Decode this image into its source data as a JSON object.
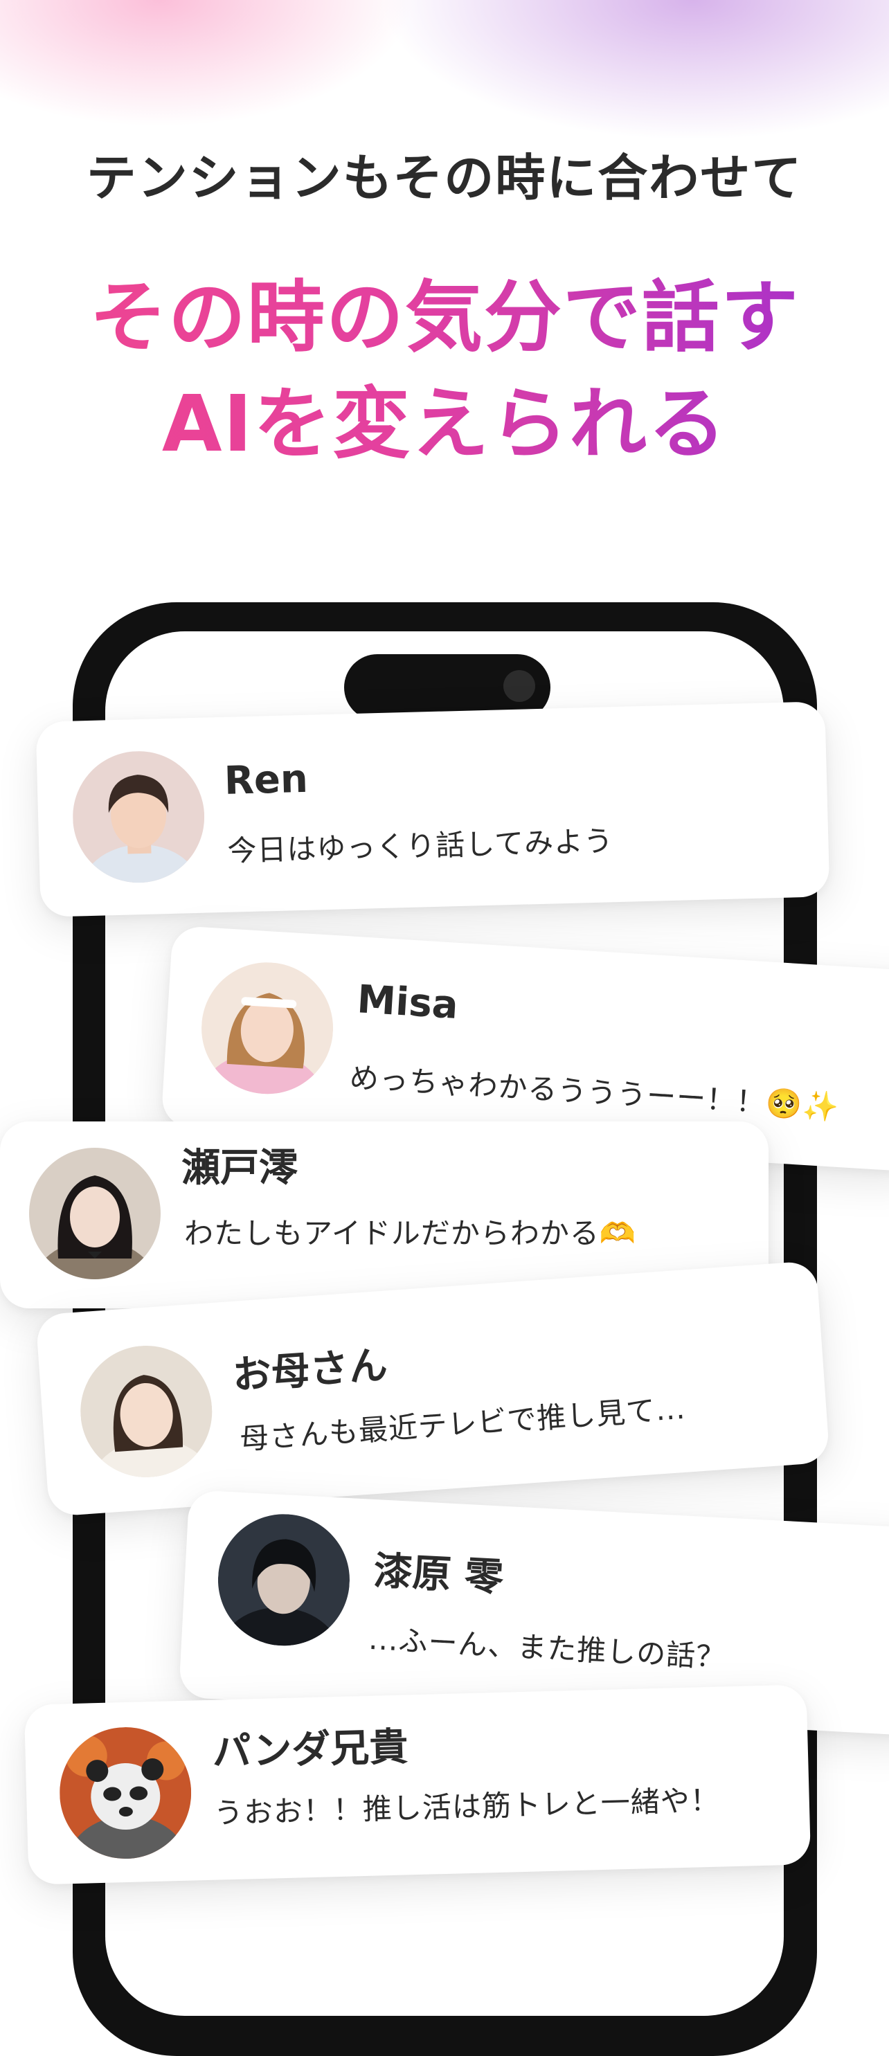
{
  "header": {
    "subtitle": "テンションもその時に合わせて",
    "headline_line1": "その時の気分で話す",
    "headline_line2": "AIを変えられる"
  },
  "chats": [
    {
      "name": "Ren",
      "message": "今日はゆっくり話してみよう",
      "avatar": "young-man-avatar"
    },
    {
      "name": "Misa",
      "message": "めっちゃわかるうううーー！！🥺✨",
      "avatar": "idol-girl-avatar"
    },
    {
      "name": "瀬戸澪",
      "message": "わたしもアイドルだからわかる🫶",
      "avatar": "schoolgirl-avatar"
    },
    {
      "name": "お母さん",
      "message": "母さんも最近テレビで推し見て...",
      "avatar": "mother-avatar"
    },
    {
      "name": "漆原 零",
      "message": "...ふーん、また推しの話？",
      "avatar": "dark-haired-man-avatar"
    },
    {
      "name": "パンダ兄貴",
      "message": "うおお！！推し活は筋トレと一緒や！",
      "avatar": "panda-avatar"
    }
  ],
  "colors": {
    "headline_start": "#f0468f",
    "headline_end": "#a02fd0",
    "text": "#2b2b2b",
    "phone": "#111111"
  }
}
